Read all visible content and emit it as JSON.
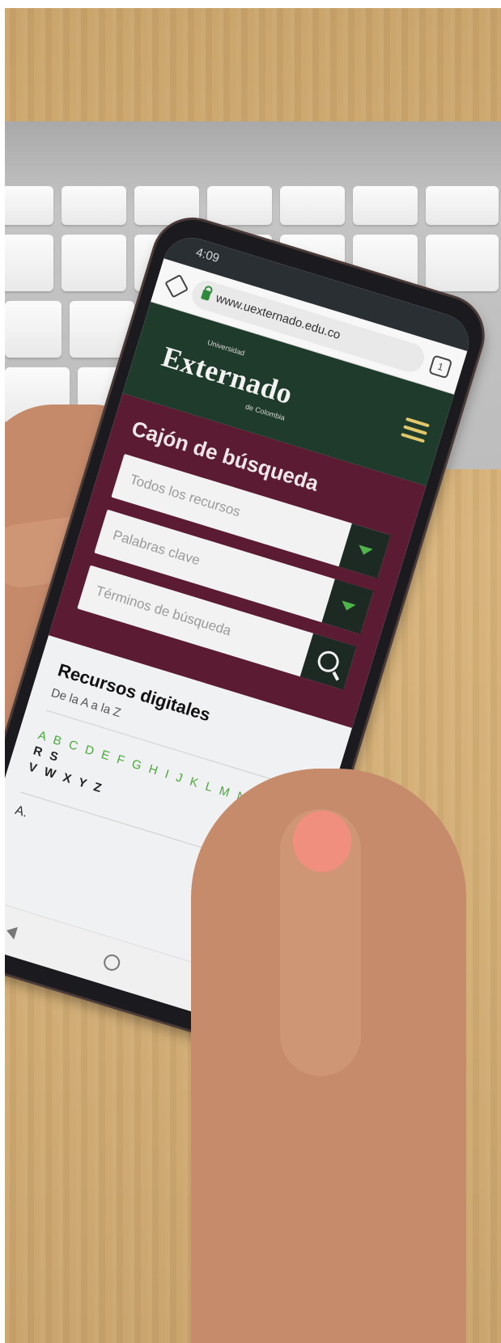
{
  "phone": {
    "status_time": "4:09",
    "url": "www.uexternado.edu.co",
    "tab_count": "1"
  },
  "header": {
    "logo_top": "Universidad",
    "logo": "Externado",
    "logo_bottom": "de Colombia"
  },
  "search": {
    "title": "Cajón de búsqueda",
    "resource_select": "Todos los recursos",
    "keyword_select": "Palabras clave",
    "terms_placeholder": "Términos de búsqueda"
  },
  "resources": {
    "title": "Recursos digitales",
    "subtitle": "De la A a la Z",
    "letters_green": "A B C D E F G H I J K L M N O P",
    "letters_dark": "Q R S",
    "letters_line2": "V W X Y Z",
    "first_item": "A."
  },
  "colors": {
    "header_green": "#1f3b2b",
    "search_maroon": "#5b1c33",
    "letter_green": "#4aa83a",
    "nail_pink": "#f08f7e"
  }
}
